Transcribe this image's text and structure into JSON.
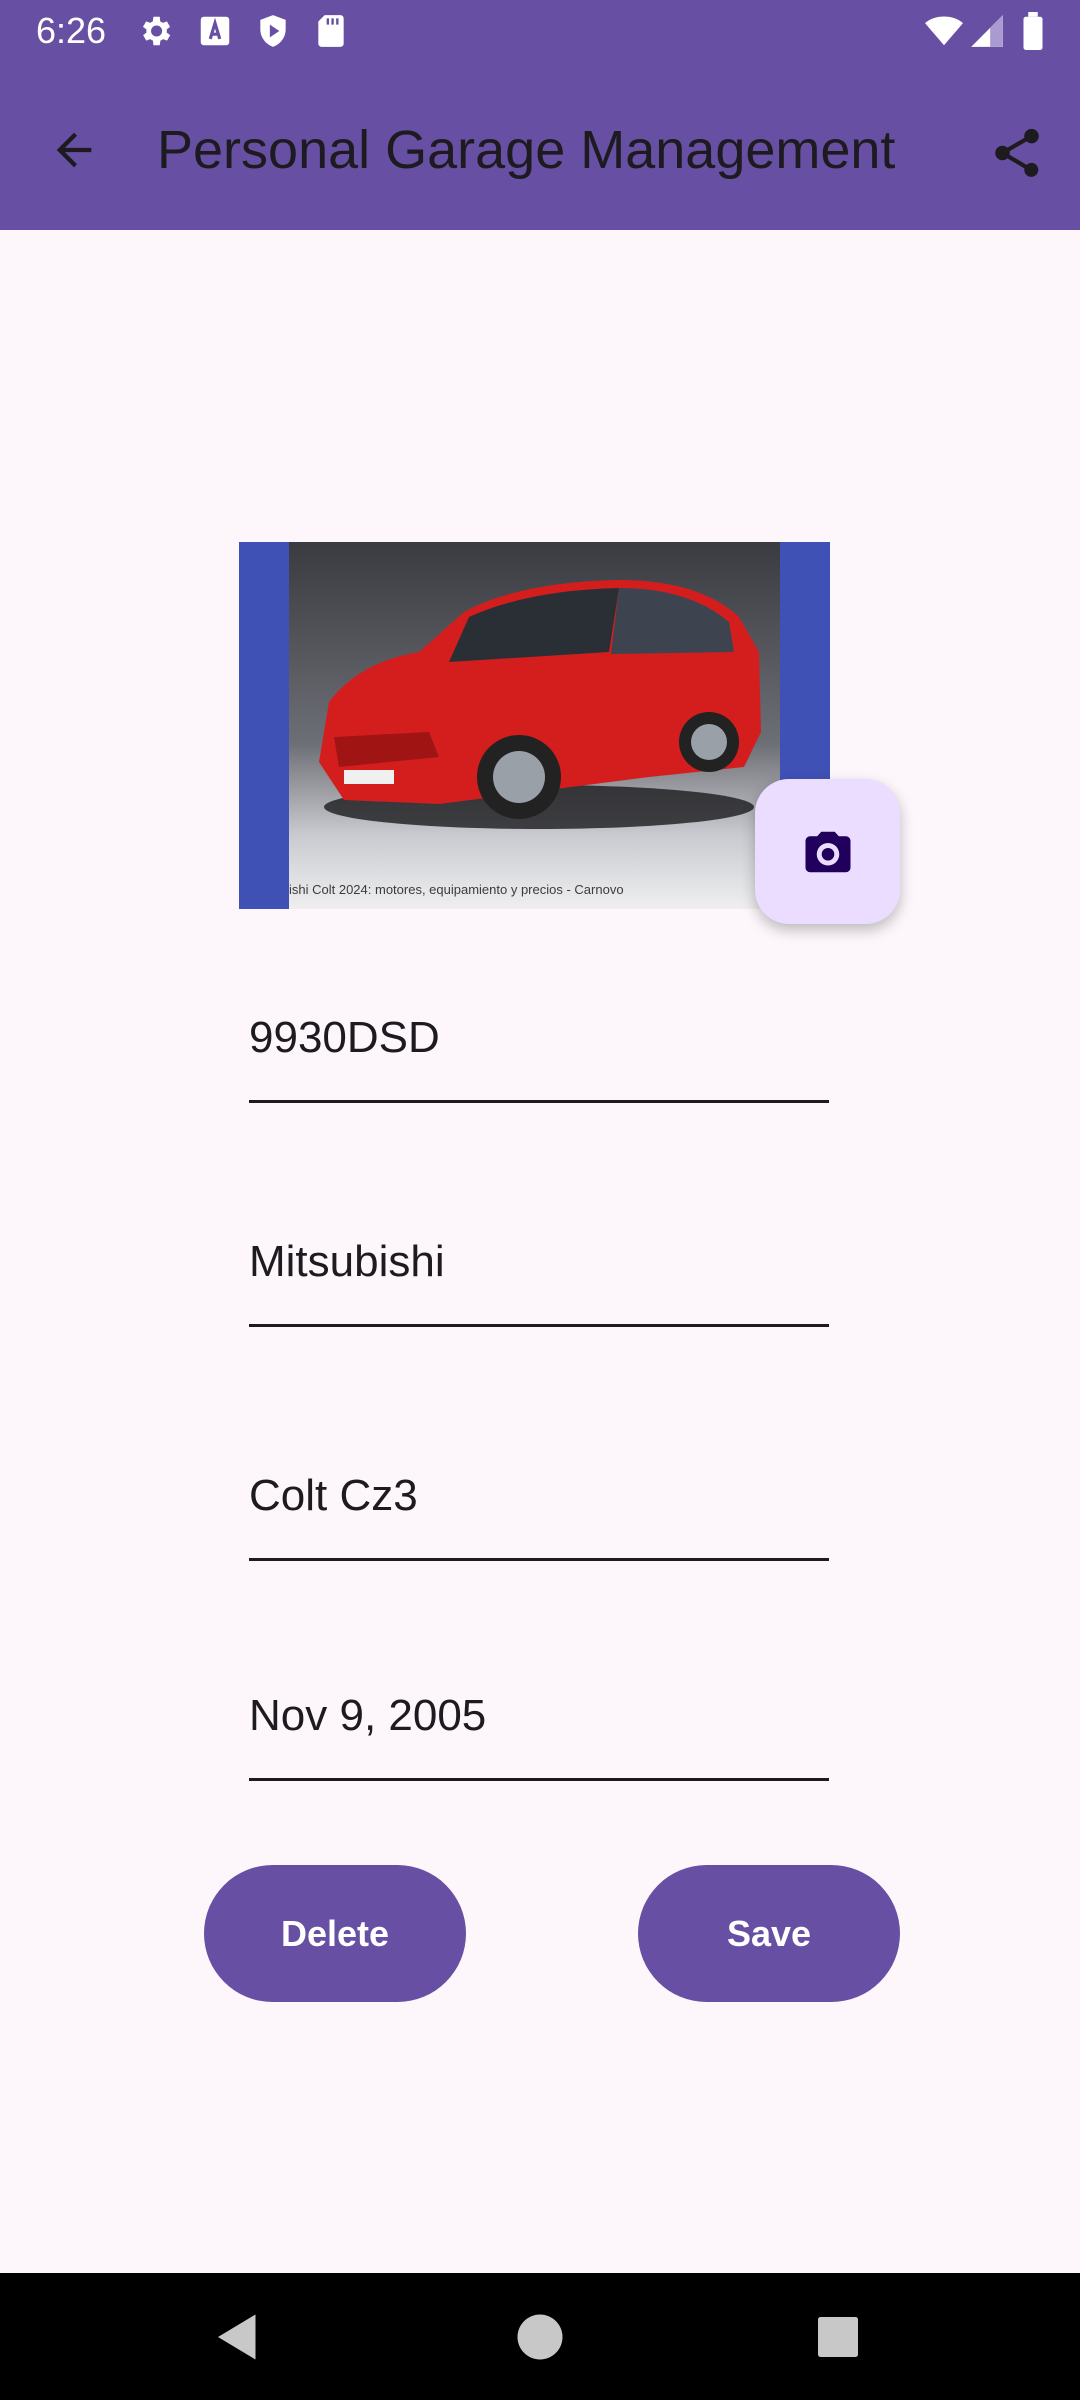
{
  "status_bar": {
    "time": "6:26",
    "left_icons": [
      "gear-icon",
      "text-a-icon",
      "shield-icon",
      "sd-card-icon"
    ],
    "right_icons": [
      "wifi-icon",
      "signal-icon",
      "battery-icon"
    ]
  },
  "app_bar": {
    "back_icon": "arrow-back-icon",
    "title": "Personal Garage Management",
    "share_icon": "share-icon",
    "background": "#6750a4"
  },
  "vehicle_photo": {
    "caption": "ishi Colt 2024: motores, equipamiento y precios - Carnovo",
    "camera_icon": "camera-icon"
  },
  "form": {
    "plate": "9930DSD",
    "brand": "Mitsubishi",
    "model": "Colt Cz3",
    "date": "Nov 9, 2005"
  },
  "actions": {
    "delete_label": "Delete",
    "save_label": "Save",
    "color": "#6750a4"
  },
  "nav_bar": {
    "items": [
      "back-triangle-icon",
      "home-circle-icon",
      "recents-square-icon"
    ]
  }
}
